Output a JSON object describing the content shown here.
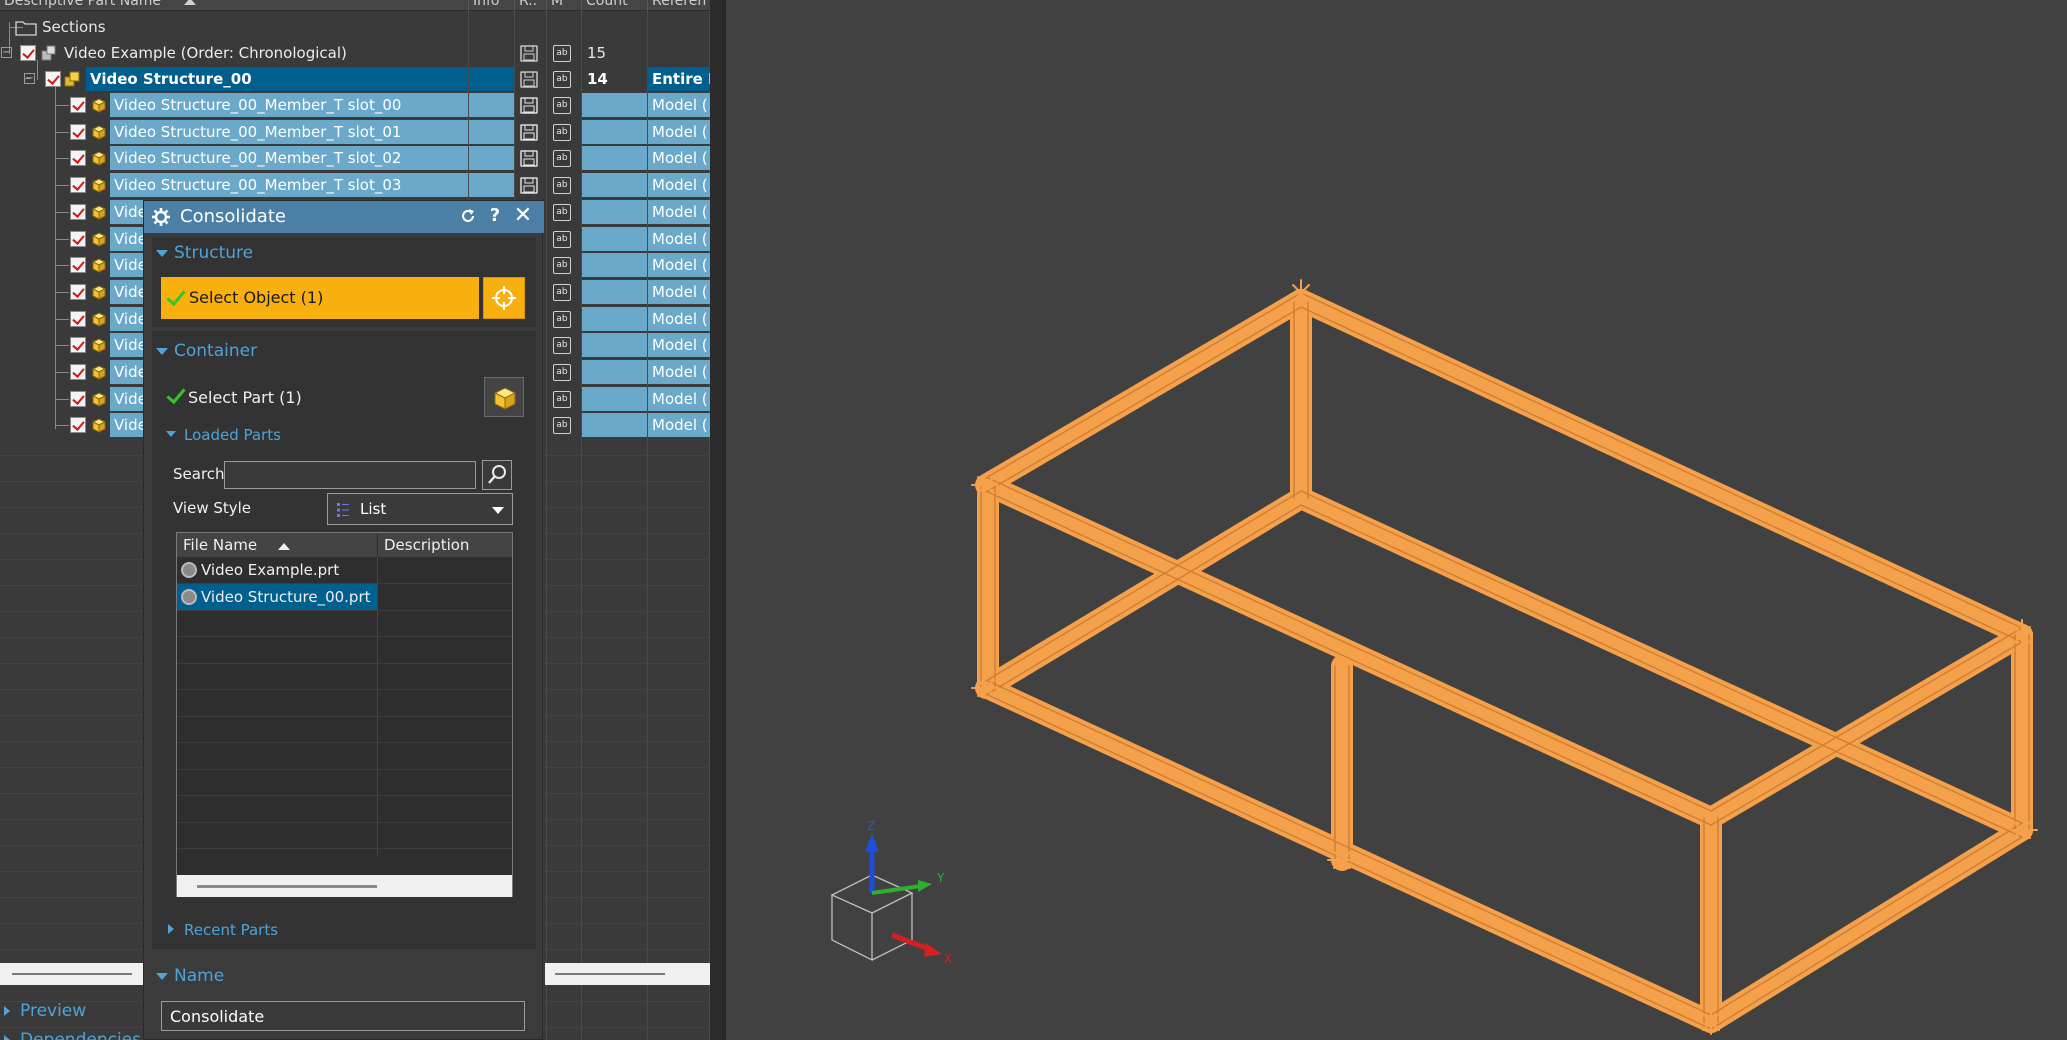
{
  "navigator": {
    "columns": [
      "Descriptive Part Name",
      "Info",
      "R..",
      "M",
      "Count",
      "Referen"
    ],
    "rows": [
      {
        "label": "Sections",
        "count": "",
        "reference": ""
      },
      {
        "label": "Video Example (Order: Chronological)",
        "count": "15",
        "reference": ""
      },
      {
        "label": "Video Structure_00",
        "count": "14",
        "reference": "Entire P"
      },
      {
        "label": "Video Structure_00_Member_T slot_00",
        "count": "",
        "reference": "Model ("
      },
      {
        "label": "Video Structure_00_Member_T slot_01",
        "count": "",
        "reference": "Model ("
      },
      {
        "label": "Video Structure_00_Member_T slot_02",
        "count": "",
        "reference": "Model ("
      },
      {
        "label": "Video Structure_00_Member_T slot_03",
        "count": "",
        "reference": "Model ("
      },
      {
        "label": "Vide",
        "count": "",
        "reference": "Model ("
      },
      {
        "label": "Vide",
        "count": "",
        "reference": "Model ("
      },
      {
        "label": "Vide",
        "count": "",
        "reference": "Model ("
      },
      {
        "label": "Vide",
        "count": "",
        "reference": "Model ("
      },
      {
        "label": "Vide",
        "count": "",
        "reference": "Model ("
      },
      {
        "label": "Vide",
        "count": "",
        "reference": "Model ("
      },
      {
        "label": "Vide",
        "count": "",
        "reference": "Model ("
      },
      {
        "label": "Vide",
        "count": "",
        "reference": "Model ("
      },
      {
        "label": "Vide",
        "count": "",
        "reference": "Model ("
      }
    ],
    "bottom_sections": [
      "Preview",
      "Dependencies"
    ]
  },
  "dialog": {
    "title": "Consolidate",
    "structure": {
      "header": "Structure",
      "select_object": "Select Object (1)"
    },
    "container": {
      "header": "Container",
      "select_part": "Select Part (1)",
      "loaded_parts": {
        "header": "Loaded Parts",
        "search_label": "Search",
        "search_value": "",
        "view_style_label": "View Style",
        "view_style_value": "List",
        "columns": [
          "File Name",
          "Description"
        ],
        "files": [
          {
            "name": "Video Example.prt",
            "description": ""
          },
          {
            "name": "Video Structure_00.prt",
            "description": ""
          }
        ]
      },
      "recent_parts": "Recent Parts"
    },
    "name": {
      "header": "Name",
      "value": "Consolidate"
    }
  },
  "viewport": {
    "model_color": "#f5a04a",
    "background_color": "#414141",
    "triad_labels": [
      "Z",
      "Y",
      "X"
    ]
  }
}
